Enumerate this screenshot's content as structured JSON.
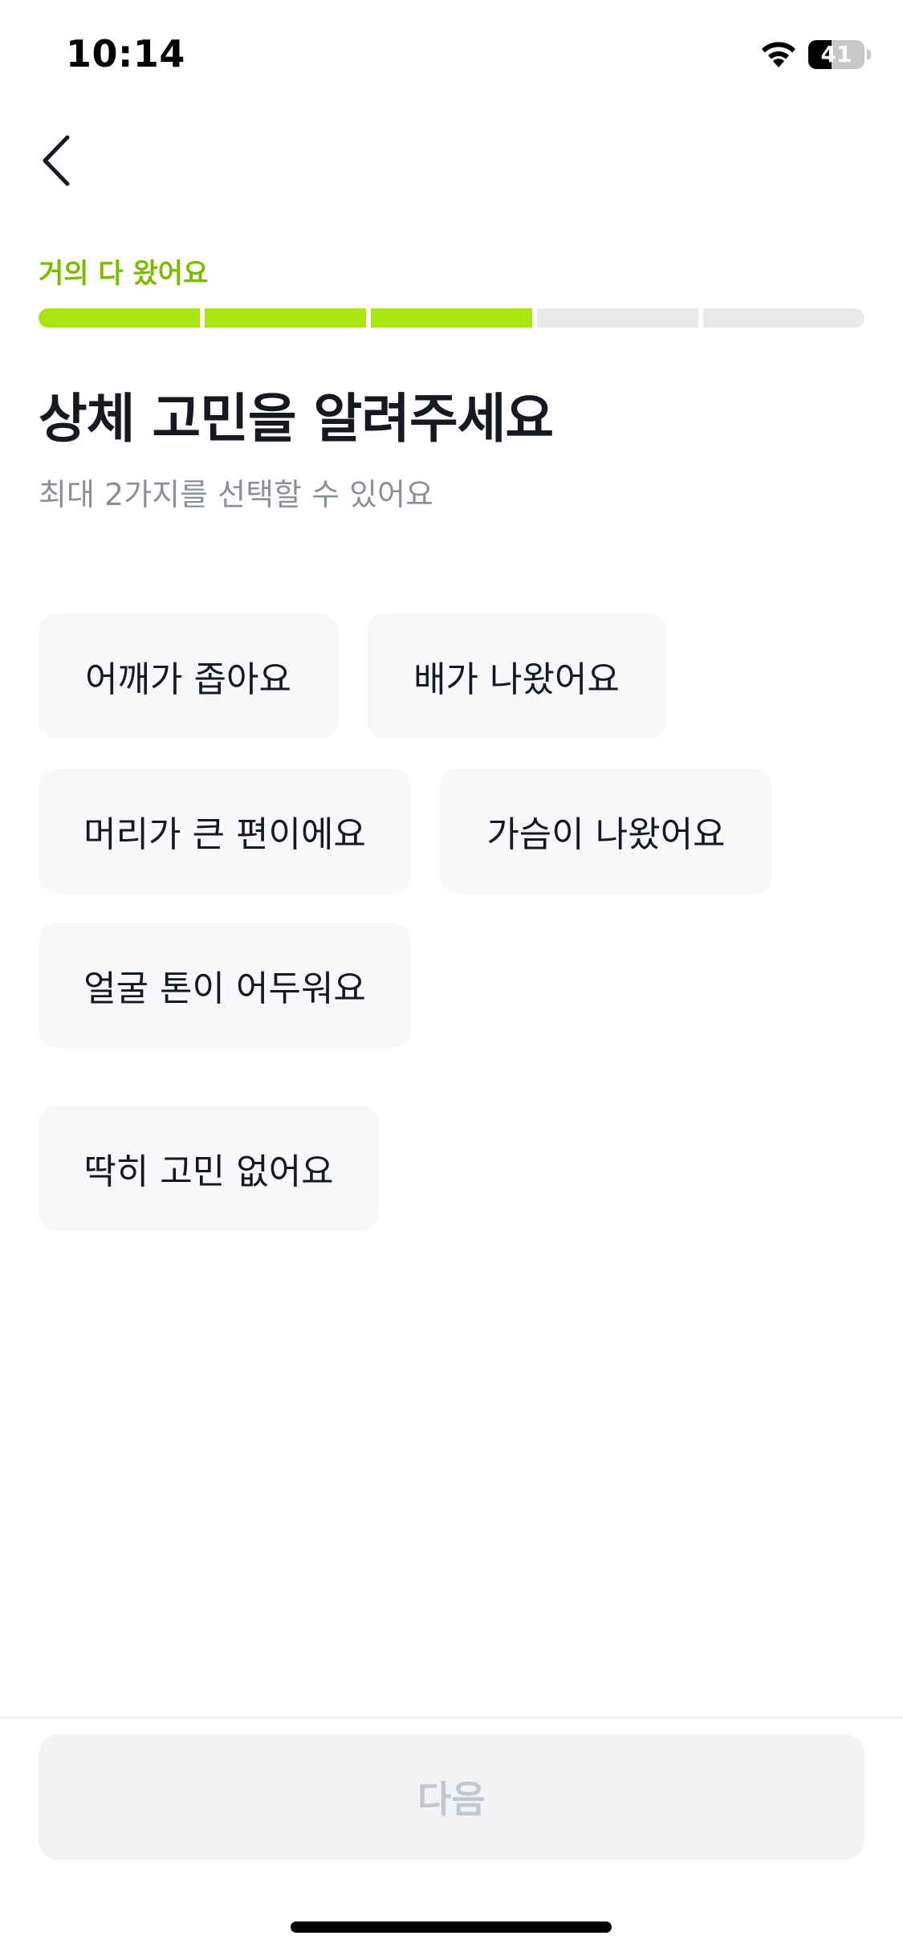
{
  "status_bar": {
    "time": "10:14",
    "battery_level": "41",
    "battery_fraction": 0.41,
    "icons": [
      "wifi-icon",
      "battery-icon"
    ]
  },
  "nav": {
    "back_icon": "chevron-left-icon"
  },
  "progress": {
    "label": "거의 다 왔어요",
    "total_steps": 5,
    "completed_steps": 3,
    "accent_color": "#a7e60f",
    "label_color": "#7cbb00",
    "track_color": "#e8e9eb"
  },
  "header": {
    "title": "상체 고민을 알려주세요",
    "subtitle": "최대 2가지를 선택할 수 있어요"
  },
  "options": [
    {
      "label": "어깨가 좁아요"
    },
    {
      "label": "배가 나왔어요"
    },
    {
      "label": "머리가 큰 편이에요"
    },
    {
      "label": "가슴이 나왔어요"
    },
    {
      "label": "얼굴 톤이 어두워요"
    },
    {
      "label": "딱히 고민 없어요"
    }
  ],
  "footer": {
    "next_label": "다음",
    "next_enabled": false
  }
}
